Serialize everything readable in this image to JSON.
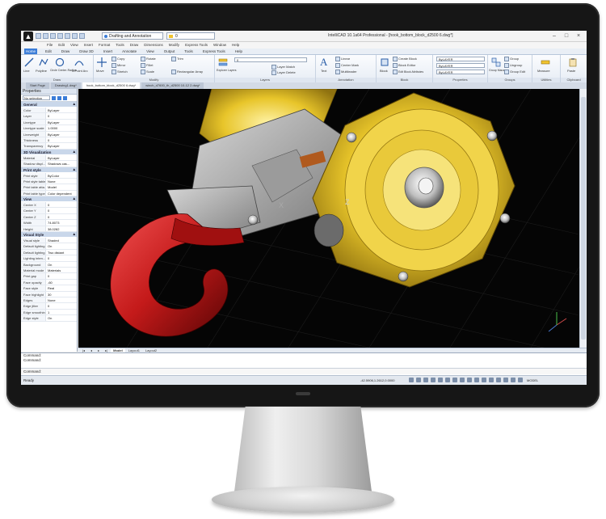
{
  "window": {
    "title": "IntelliCAD 10.1a64 Professional - [hook_bottom_block_d2500 6.dwg*]",
    "workspace": "Drafting and Annotation",
    "layer_quick": "0"
  },
  "menu": [
    "File",
    "Edit",
    "View",
    "Insert",
    "Format",
    "Tools",
    "Draw",
    "Dimensions",
    "Modify",
    "Express Tools",
    "Window",
    "Help"
  ],
  "ribbon_tabs": [
    "Home",
    "Edit",
    "Draw",
    "Draw 3D",
    "Insert",
    "Annotate",
    "View",
    "Output",
    "Tools",
    "Express Tools",
    "Help"
  ],
  "ribbon_active": "Home",
  "ribbon_groups": {
    "draw": {
      "label": "Draw",
      "line": "Line",
      "polyline": "Polyline",
      "circle": "Circle Center-Radius",
      "arc": "3-Point Arc"
    },
    "modify": {
      "label": "Modify",
      "move": "Move",
      "copy": "Copy",
      "rotate": "Rotate",
      "trim": "Trim",
      "mirror": "Mirror",
      "fillet": "Fillet",
      "stretch": "Stretch",
      "scale": "Scale",
      "array": "Rectangular Array"
    },
    "layers": {
      "label": "Layers",
      "explorer": "Explorer Layers",
      "layer_value": "0",
      "layer_match": "Layer Match",
      "layer_delete": "Layer Delete"
    },
    "annotation": {
      "label": "Annotation",
      "text": "Text",
      "linear": "Linear",
      "center_mark": "Center Mark",
      "multileader": "Multileader",
      "table": "Table"
    },
    "block": {
      "label": "Block",
      "insert": "Block",
      "create": "Create Block",
      "editor": "Block Editor",
      "attributes": "Edit Block Attributes"
    },
    "properties": {
      "label": "Properties",
      "color": "ByLAYER",
      "linetype": "ByLAYER",
      "lineweight": "ByLAYER"
    },
    "groups": {
      "label": "Groups",
      "manager": "Group Manager",
      "ungroup": "Ungroup",
      "group_edit": "Group Edit",
      "group": "Group"
    },
    "utilities": {
      "label": "Utilities",
      "measure": "Measure"
    },
    "clipboard": {
      "label": "Clipboard",
      "paste": "Paste"
    }
  },
  "doc_tabs": [
    {
      "label": "Start Page",
      "active": false
    },
    {
      "label": "Drawing1.dwg*",
      "active": false
    },
    {
      "label": "hook_bottom_block_d2500 6.dwg*",
      "active": true
    },
    {
      "label": "winch_d7600_th_d2500 10-12 2.dwg*",
      "active": false
    }
  ],
  "properties": {
    "title": "Properties",
    "selection": "No selection",
    "sections": [
      {
        "name": "General",
        "rows": [
          [
            "Color",
            "ByLayer"
          ],
          [
            "Layer",
            "0"
          ],
          [
            "Linetype",
            "ByLayer"
          ],
          [
            "Linetype scale",
            "1.0000"
          ],
          [
            "Lineweight",
            "ByLayer"
          ],
          [
            "Thickness",
            "0"
          ],
          [
            "Transparency",
            "ByLayer"
          ]
        ]
      },
      {
        "name": "3D Visualization",
        "rows": [
          [
            "Material",
            "ByLayer"
          ],
          [
            "Shadow displ...",
            "Shadows cas..."
          ]
        ]
      },
      {
        "name": "Print style",
        "rows": [
          [
            "Print style",
            "ByColor"
          ],
          [
            "Print style table",
            "None"
          ],
          [
            "Print table atta...",
            "Model"
          ],
          [
            "Print table type",
            "Color dependent"
          ]
        ]
      },
      {
        "name": "View",
        "rows": [
          [
            "Center X",
            "0"
          ],
          [
            "Center Y",
            "0"
          ],
          [
            "Center Z",
            "0"
          ],
          [
            "Width",
            "74.8073"
          ],
          [
            "Height",
            "38.0282"
          ]
        ]
      },
      {
        "name": "Visual Style",
        "rows": [
          [
            "Visual style",
            "Shaded"
          ],
          [
            "Default lighting",
            "On"
          ],
          [
            "Default lighting...",
            "Two distant"
          ],
          [
            "Lighting inten...",
            "0"
          ],
          [
            "Background",
            "On"
          ],
          [
            "Material mode",
            "Materials"
          ],
          [
            "Print gap",
            "0"
          ],
          [
            "Face opacity",
            "-60"
          ],
          [
            "Face style",
            "Real"
          ],
          [
            "Face highlight",
            "30"
          ],
          [
            "Edges",
            "None"
          ],
          [
            "Edge jitter",
            "0"
          ],
          [
            "Edge smoothin...",
            "1"
          ],
          [
            "Edge style",
            "On"
          ]
        ]
      }
    ]
  },
  "layout_tabs": [
    "Model",
    "Layout1",
    "Layout2"
  ],
  "command": {
    "history": [
      "Command:",
      "Command:"
    ],
    "prompt": "Command:"
  },
  "status": {
    "ready": "Ready",
    "coords": "-42.5906,1.2612,0.0000",
    "model": "MODEL"
  },
  "colors": {
    "accent": "#3b7dd8",
    "hook_red": "#c41a1a",
    "pulley_gold": "#e8c52a",
    "viewport_bg": "#050505"
  }
}
